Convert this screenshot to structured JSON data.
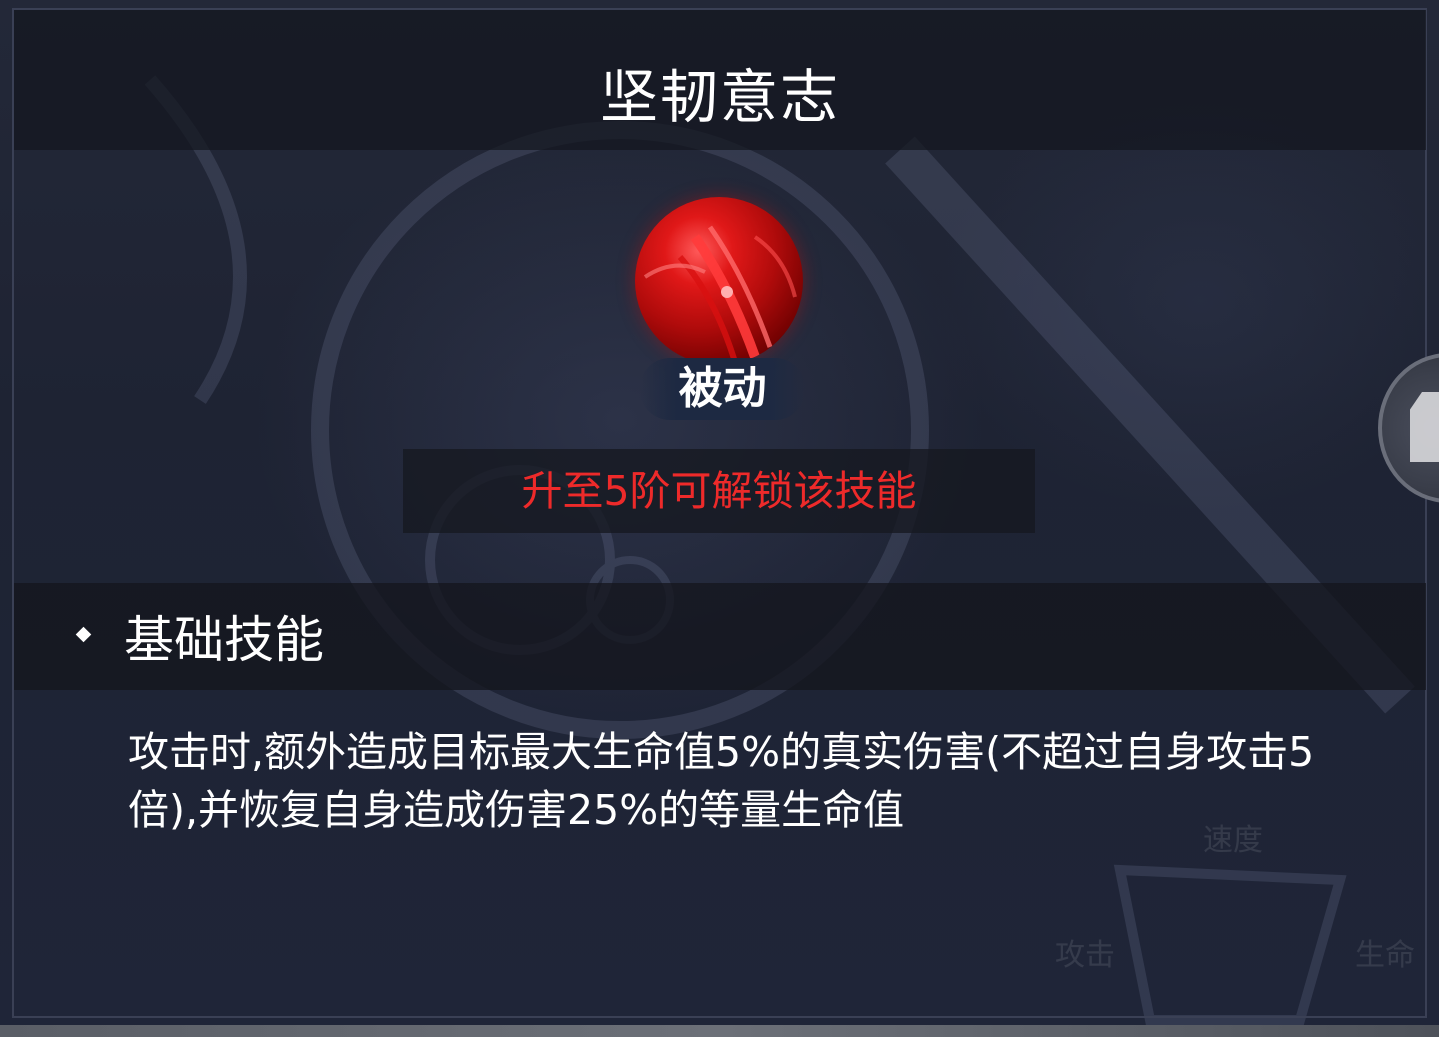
{
  "skill": {
    "name": "坚韧意志",
    "type_label": "被动",
    "unlock_requirement": "升至5阶可解锁该技能",
    "section_title": "基础技能",
    "description": "攻击时,额外造成目标最大生命值5%的真实伤害(不超过自身攻击5倍),并恢复自身造成伤害25%的等量生命值"
  },
  "background_labels": {
    "speed": "速度",
    "attack": "攻击",
    "health": "生命"
  },
  "icons": {
    "skill_icon": "red-claw-orb-icon",
    "side_button_icon": "box-icon",
    "bullet_icon": "diamond-bullet-icon"
  },
  "colors": {
    "unlock_text": "#ee2a2a",
    "panel_bg": "#1c2131",
    "orb_red": "#b00b0b"
  }
}
